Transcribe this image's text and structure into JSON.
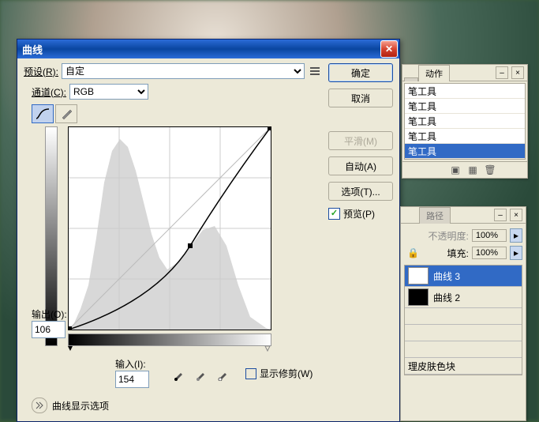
{
  "dialog": {
    "title": "曲线",
    "preset_label": "预设(R):",
    "preset_value": "自定",
    "channel_label": "通道(C):",
    "channel_value": "RGB",
    "output_label": "输出(O):",
    "output_value": "106",
    "input_label": "输入(I):",
    "input_value": "154",
    "show_clip_label": "显示修剪(W)",
    "display_options_label": "曲线显示选项",
    "buttons": {
      "ok": "确定",
      "cancel": "取消",
      "smooth": "平滑(M)",
      "auto": "自动(A)",
      "options": "选项(T)..."
    },
    "preview_label": "预览(P)"
  },
  "actions_panel": {
    "tab_hidden": "",
    "tab_active": "动作",
    "items": [
      "笔工具",
      "笔工具",
      "笔工具",
      "笔工具",
      "笔工具"
    ]
  },
  "layers_panel": {
    "tab_paths": "路径",
    "opacity_label": "不透明度:",
    "opacity_value": "100%",
    "fill_label": "填充:",
    "fill_value": "100%",
    "layers": [
      {
        "name": "曲线 3",
        "selected": true,
        "thumb": "white"
      },
      {
        "name": "曲线 2",
        "selected": false,
        "thumb": "black"
      },
      {
        "name": "",
        "selected": false,
        "thumb": "none"
      },
      {
        "name": "",
        "selected": false,
        "thumb": "none"
      },
      {
        "name": "",
        "selected": false,
        "thumb": "none"
      },
      {
        "name": "理皮肤色块",
        "selected": false,
        "thumb": "none"
      }
    ]
  },
  "chart_data": {
    "type": "line",
    "title": "",
    "xlabel": "输入",
    "ylabel": "输出",
    "xlim": [
      0,
      255
    ],
    "ylim": [
      0,
      255
    ],
    "series": [
      {
        "name": "curve",
        "x": [
          0,
          154,
          255
        ],
        "y": [
          0,
          106,
          255
        ]
      },
      {
        "name": "baseline",
        "x": [
          0,
          255
        ],
        "y": [
          0,
          255
        ]
      }
    ],
    "histogram_peaks_x": [
      40,
      70,
      90,
      180
    ],
    "selected_point": {
      "x": 154,
      "y": 106
    }
  }
}
